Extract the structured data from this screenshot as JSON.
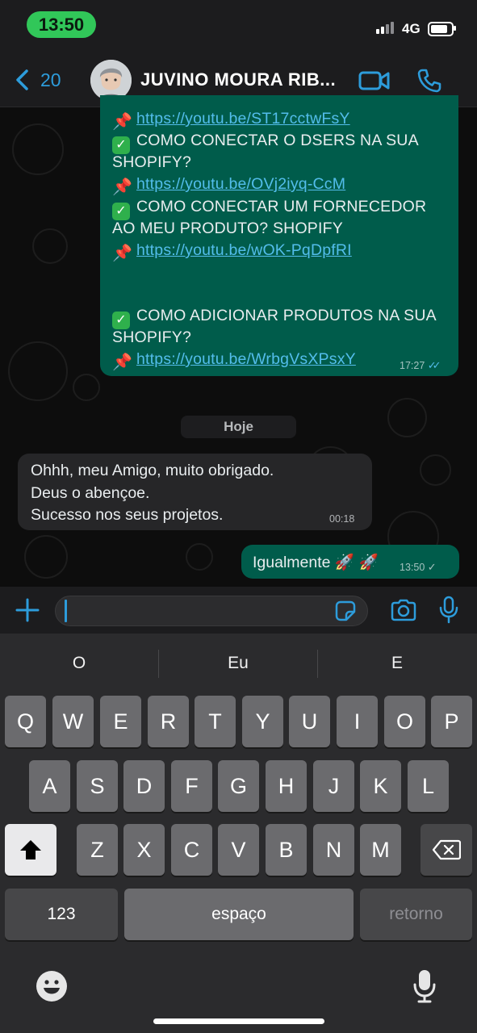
{
  "status": {
    "time": "13:50",
    "network": "4G"
  },
  "header": {
    "back_count": "20",
    "contact_name": "JUVINO MOURA RIB..."
  },
  "chat": {
    "outgoing_1": {
      "lines": [
        {
          "emoji": "pin",
          "link": "https://youtu.be/ST17cctwFsY"
        },
        {
          "emoji": "check",
          "text": "COMO CONECTAR O DSERS NA SUA"
        },
        {
          "text": "SHOPIFY?"
        },
        {
          "emoji": "pin",
          "link": "https://youtu.be/OVj2iyq-CcM"
        },
        {
          "emoji": "check",
          "text": "COMO CONECTAR UM FORNECEDOR"
        },
        {
          "text": "AO MEU PRODUTO? SHOPIFY"
        },
        {
          "emoji": "pin",
          "link": "https://youtu.be/wOK-PqDpfRI"
        },
        {
          "emoji": "check",
          "text": "COMO ADICIONAR PRODUTOS NA SUA"
        },
        {
          "text": "SHOPIFY?"
        },
        {
          "emoji": "pin",
          "link": "https://youtu.be/WrbgVsXPsxY"
        }
      ],
      "time": "17:27"
    },
    "date_separator": "Hoje",
    "incoming": {
      "lines": [
        "Ohhh, meu Amigo, muito obrigado.",
        "Deus o abençoe.",
        "Sucesso nos seus projetos."
      ],
      "time": "00:18"
    },
    "outgoing_2": {
      "text": "Igualmente 🚀 🚀",
      "time": "13:50"
    }
  },
  "input": {
    "value": "",
    "placeholder": ""
  },
  "keyboard": {
    "suggestions": [
      "O",
      "Eu",
      "E"
    ],
    "row1": [
      "Q",
      "W",
      "E",
      "R",
      "T",
      "Y",
      "U",
      "I",
      "O",
      "P"
    ],
    "row2": [
      "A",
      "S",
      "D",
      "F",
      "G",
      "H",
      "J",
      "K",
      "L"
    ],
    "row3": [
      "Z",
      "X",
      "C",
      "V",
      "B",
      "N",
      "M"
    ],
    "numbers_label": "123",
    "space_label": "espaço",
    "return_label": "retorno"
  },
  "colors": {
    "outgoing_bubble": "#005c4b",
    "accent_blue": "#2d9cdb",
    "link": "#53bdeb",
    "incoming_bubble": "#262628"
  }
}
